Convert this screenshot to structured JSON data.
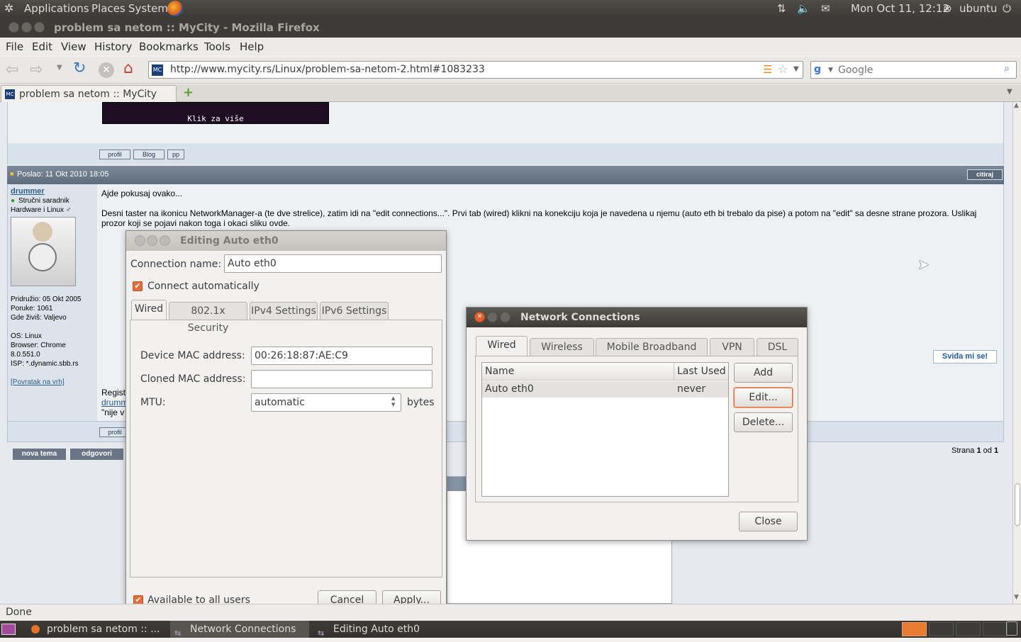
{
  "top_panel": {
    "applications": "Applications",
    "places": "Places",
    "system": "System",
    "datetime": "Mon Oct 11, 12:12",
    "user": "ubuntu"
  },
  "firefox": {
    "title": "problem sa netom :: MyCity - Mozilla Firefox",
    "menu": [
      "File",
      "Edit",
      "View",
      "History",
      "Bookmarks",
      "Tools",
      "Help"
    ],
    "url": "http://www.mycity.rs/Linux/problem-sa-netom-2.html#1083233",
    "search_placeholder": "Google",
    "tab_title": "problem sa netom :: MyCity",
    "status": "Done"
  },
  "forum": {
    "banner_caption": "Klik za više",
    "buttons": [
      "profil",
      "Blog",
      "pp"
    ],
    "post_header": "Poslao: 11 Okt 2010 18:05",
    "quote_btn": "citiraj",
    "username": "drummer",
    "rank": "Stručni saradnik",
    "forum_section": "Hardware i Linux ♂",
    "info": [
      "Pridružio: 05 Okt 2005",
      "Poruke: 1061",
      "Gde živiš: Valjevo",
      "",
      "OS: Linux",
      "Browser: Chrome 8.0.551.0",
      "ISP: *.dynamic.sbb.rs"
    ],
    "back_to_top": "[Povratak na vrh]",
    "post_line1": "Ajde pokusaj ovako...",
    "post_line2": "Desni taster na ikonicu NetworkManager-a (te dve strelice), zatim idi na \"edit connections...\". Prvi tab (wired) klikni na konekciju koja je navedena u njemu (auto eth bi trebalo da pise) a potom na \"edit\" sa desne strane prozora. Uslikaj prozor koji se pojavi nakon toga i okaci sliku ovde.",
    "signature_frag": [
      "Regist",
      "drumm",
      "\"nije v"
    ],
    "like_btn": "Sviđa mi se!",
    "profil_btn": "profil",
    "new_topic": "nova tema",
    "reply": "odgovori",
    "page_info_pre": "Strana ",
    "page_cur": "1",
    "page_mid": " od ",
    "page_total": "1"
  },
  "editing_dialog": {
    "title": "Editing Auto eth0",
    "conn_name_label": "Connection name:",
    "conn_name": "Auto eth0",
    "connect_auto": "Connect automatically",
    "tabs": [
      "Wired",
      "802.1x Security",
      "IPv4 Settings",
      "IPv6 Settings"
    ],
    "mac_label": "Device MAC address:",
    "mac_value": "00:26:18:87:AE:C9",
    "cloned_label": "Cloned MAC address:",
    "cloned_value": "",
    "mtu_label": "MTU:",
    "mtu_value": "automatic",
    "mtu_unit": "bytes",
    "all_users": "Available to all users",
    "cancel": "Cancel",
    "apply": "Apply..."
  },
  "netconn_dialog": {
    "title": "Network Connections",
    "tabs": [
      "Wired",
      "Wireless",
      "Mobile Broadband",
      "VPN",
      "DSL"
    ],
    "col_name": "Name",
    "col_last": "Last Used",
    "rows": [
      {
        "name": "Auto eth0",
        "last": "never"
      }
    ],
    "add": "Add",
    "edit": "Edit...",
    "delete": "Delete...",
    "close": "Close"
  },
  "taskbar": [
    "problem sa netom :: ...",
    "Network Connections",
    "Editing Auto eth0"
  ],
  "colors": {
    "accent": "#e46d3c",
    "panel": "#3c3b37",
    "forum_header": "#6d7b8a"
  }
}
